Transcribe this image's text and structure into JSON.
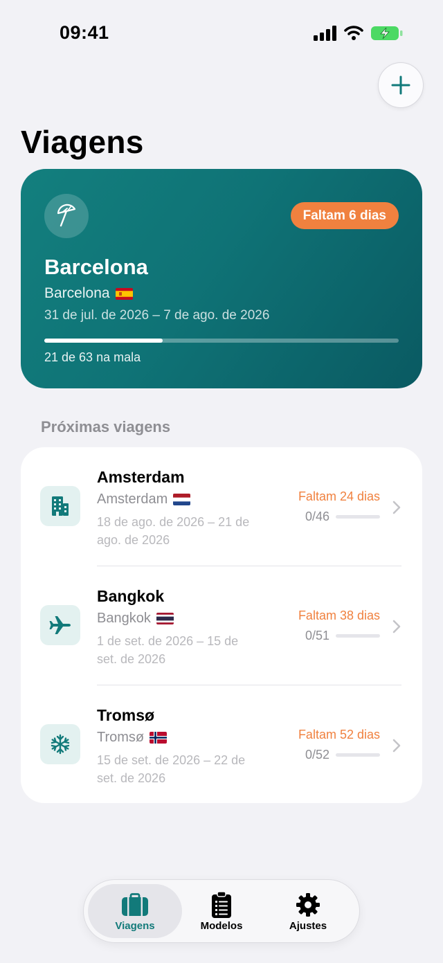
{
  "status_bar": {
    "time": "09:41"
  },
  "header": {
    "title": "Viagens",
    "add_icon": "plus-icon"
  },
  "featured_trip": {
    "icon": "beach-umbrella-icon",
    "name": "Barcelona",
    "location": "Barcelona",
    "flag": "spain-flag",
    "dates": "31 de jul. de 2026 – 7 de ago. de 2026",
    "countdown": "Faltam 6 dias",
    "packed_label": "21 de 63 na mala",
    "packed": 21,
    "total": 63
  },
  "upcoming": {
    "section_title": "Próximas viagens",
    "trips": [
      {
        "name": "Amsterdam",
        "location": "Amsterdam",
        "flag": "netherlands-flag",
        "icon": "building-icon",
        "dates": "18 de ago. de 2026 – 21 de ago. de 2026",
        "countdown": "Faltam 24 dias",
        "count": "0/46",
        "progress": 0
      },
      {
        "name": "Bangkok",
        "location": "Bangkok",
        "flag": "thailand-flag",
        "icon": "airplane-icon",
        "dates": "1 de set. de 2026 – 15 de set. de 2026",
        "countdown": "Faltam 38 dias",
        "count": "0/51",
        "progress": 0
      },
      {
        "name": "Tromsø",
        "location": "Tromsø",
        "flag": "norway-flag",
        "icon": "snowflake-icon",
        "dates": "15 de set. de 2026 – 22 de set. de 2026",
        "countdown": "Faltam 52 dias",
        "count": "0/52",
        "progress": 0
      }
    ]
  },
  "tab_bar": {
    "tabs": [
      {
        "label": "Viagens",
        "icon": "suitcase-icon",
        "active": true
      },
      {
        "label": "Modelos",
        "icon": "checklist-icon",
        "active": false
      },
      {
        "label": "Ajustes",
        "icon": "gear-icon",
        "active": false
      }
    ]
  },
  "colors": {
    "accent": "#127a7a",
    "countdown": "#f0813f",
    "background": "#f2f2f6"
  }
}
